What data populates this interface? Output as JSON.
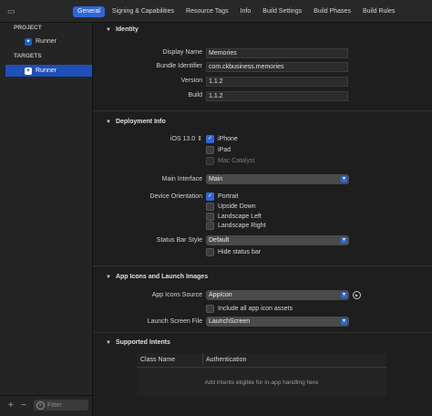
{
  "toolbar": {
    "left_icon": "target-editor-icon",
    "tabs": [
      {
        "label": "General",
        "active": true
      },
      {
        "label": "Signing & Capabilities",
        "active": false
      },
      {
        "label": "Resource Tags",
        "active": false
      },
      {
        "label": "Info",
        "active": false
      },
      {
        "label": "Build Settings",
        "active": false
      },
      {
        "label": "Build Phases",
        "active": false
      },
      {
        "label": "Build Rules",
        "active": false
      }
    ]
  },
  "sidebar": {
    "project_header": "PROJECT",
    "project_item": "Runner",
    "targets_header": "TARGETS",
    "target_item": "Runner",
    "add_label": "+",
    "remove_label": "−",
    "filter_placeholder": "Filter"
  },
  "identity": {
    "title": "Identity",
    "display_name_label": "Display Name",
    "display_name": "Memories",
    "bundle_id_label": "Bundle Identifier",
    "bundle_id": "com.ckbusiness.memories",
    "version_label": "Version",
    "version": "1.1.2",
    "build_label": "Build",
    "build": "1.1.2"
  },
  "deployment": {
    "title": "Deployment Info",
    "ios_version": "iOS 13.0",
    "devices": [
      {
        "label": "iPhone",
        "checked": true,
        "enabled": true
      },
      {
        "label": "iPad",
        "checked": false,
        "enabled": true
      },
      {
        "label": "Mac Catalyst",
        "checked": false,
        "enabled": false
      }
    ],
    "main_interface_label": "Main Interface",
    "main_interface": "Main",
    "orientation_label": "Device Orientation",
    "orientations": [
      {
        "label": "Portrait",
        "checked": true
      },
      {
        "label": "Upside Down",
        "checked": false
      },
      {
        "label": "Landscape Left",
        "checked": false
      },
      {
        "label": "Landscape Right",
        "checked": false
      }
    ],
    "status_bar_label": "Status Bar Style",
    "status_bar": "Default",
    "hide_status_bar": "Hide status bar"
  },
  "app_icons": {
    "title": "App Icons and Launch Images",
    "source_label": "App Icons Source",
    "source": "AppIcon",
    "include_all": "Include all app icon assets",
    "launch_label": "Launch Screen File",
    "launch": "LaunchScreen"
  },
  "intents": {
    "title": "Supported Intents",
    "col_class": "Class Name",
    "col_auth": "Authentication",
    "empty": "Add intents eligible for in-app handling here"
  },
  "colors": {
    "accent": "#2f66d8",
    "selection": "#1f4fb8",
    "background": "#1e1e1e",
    "sidebar": "#242424"
  }
}
